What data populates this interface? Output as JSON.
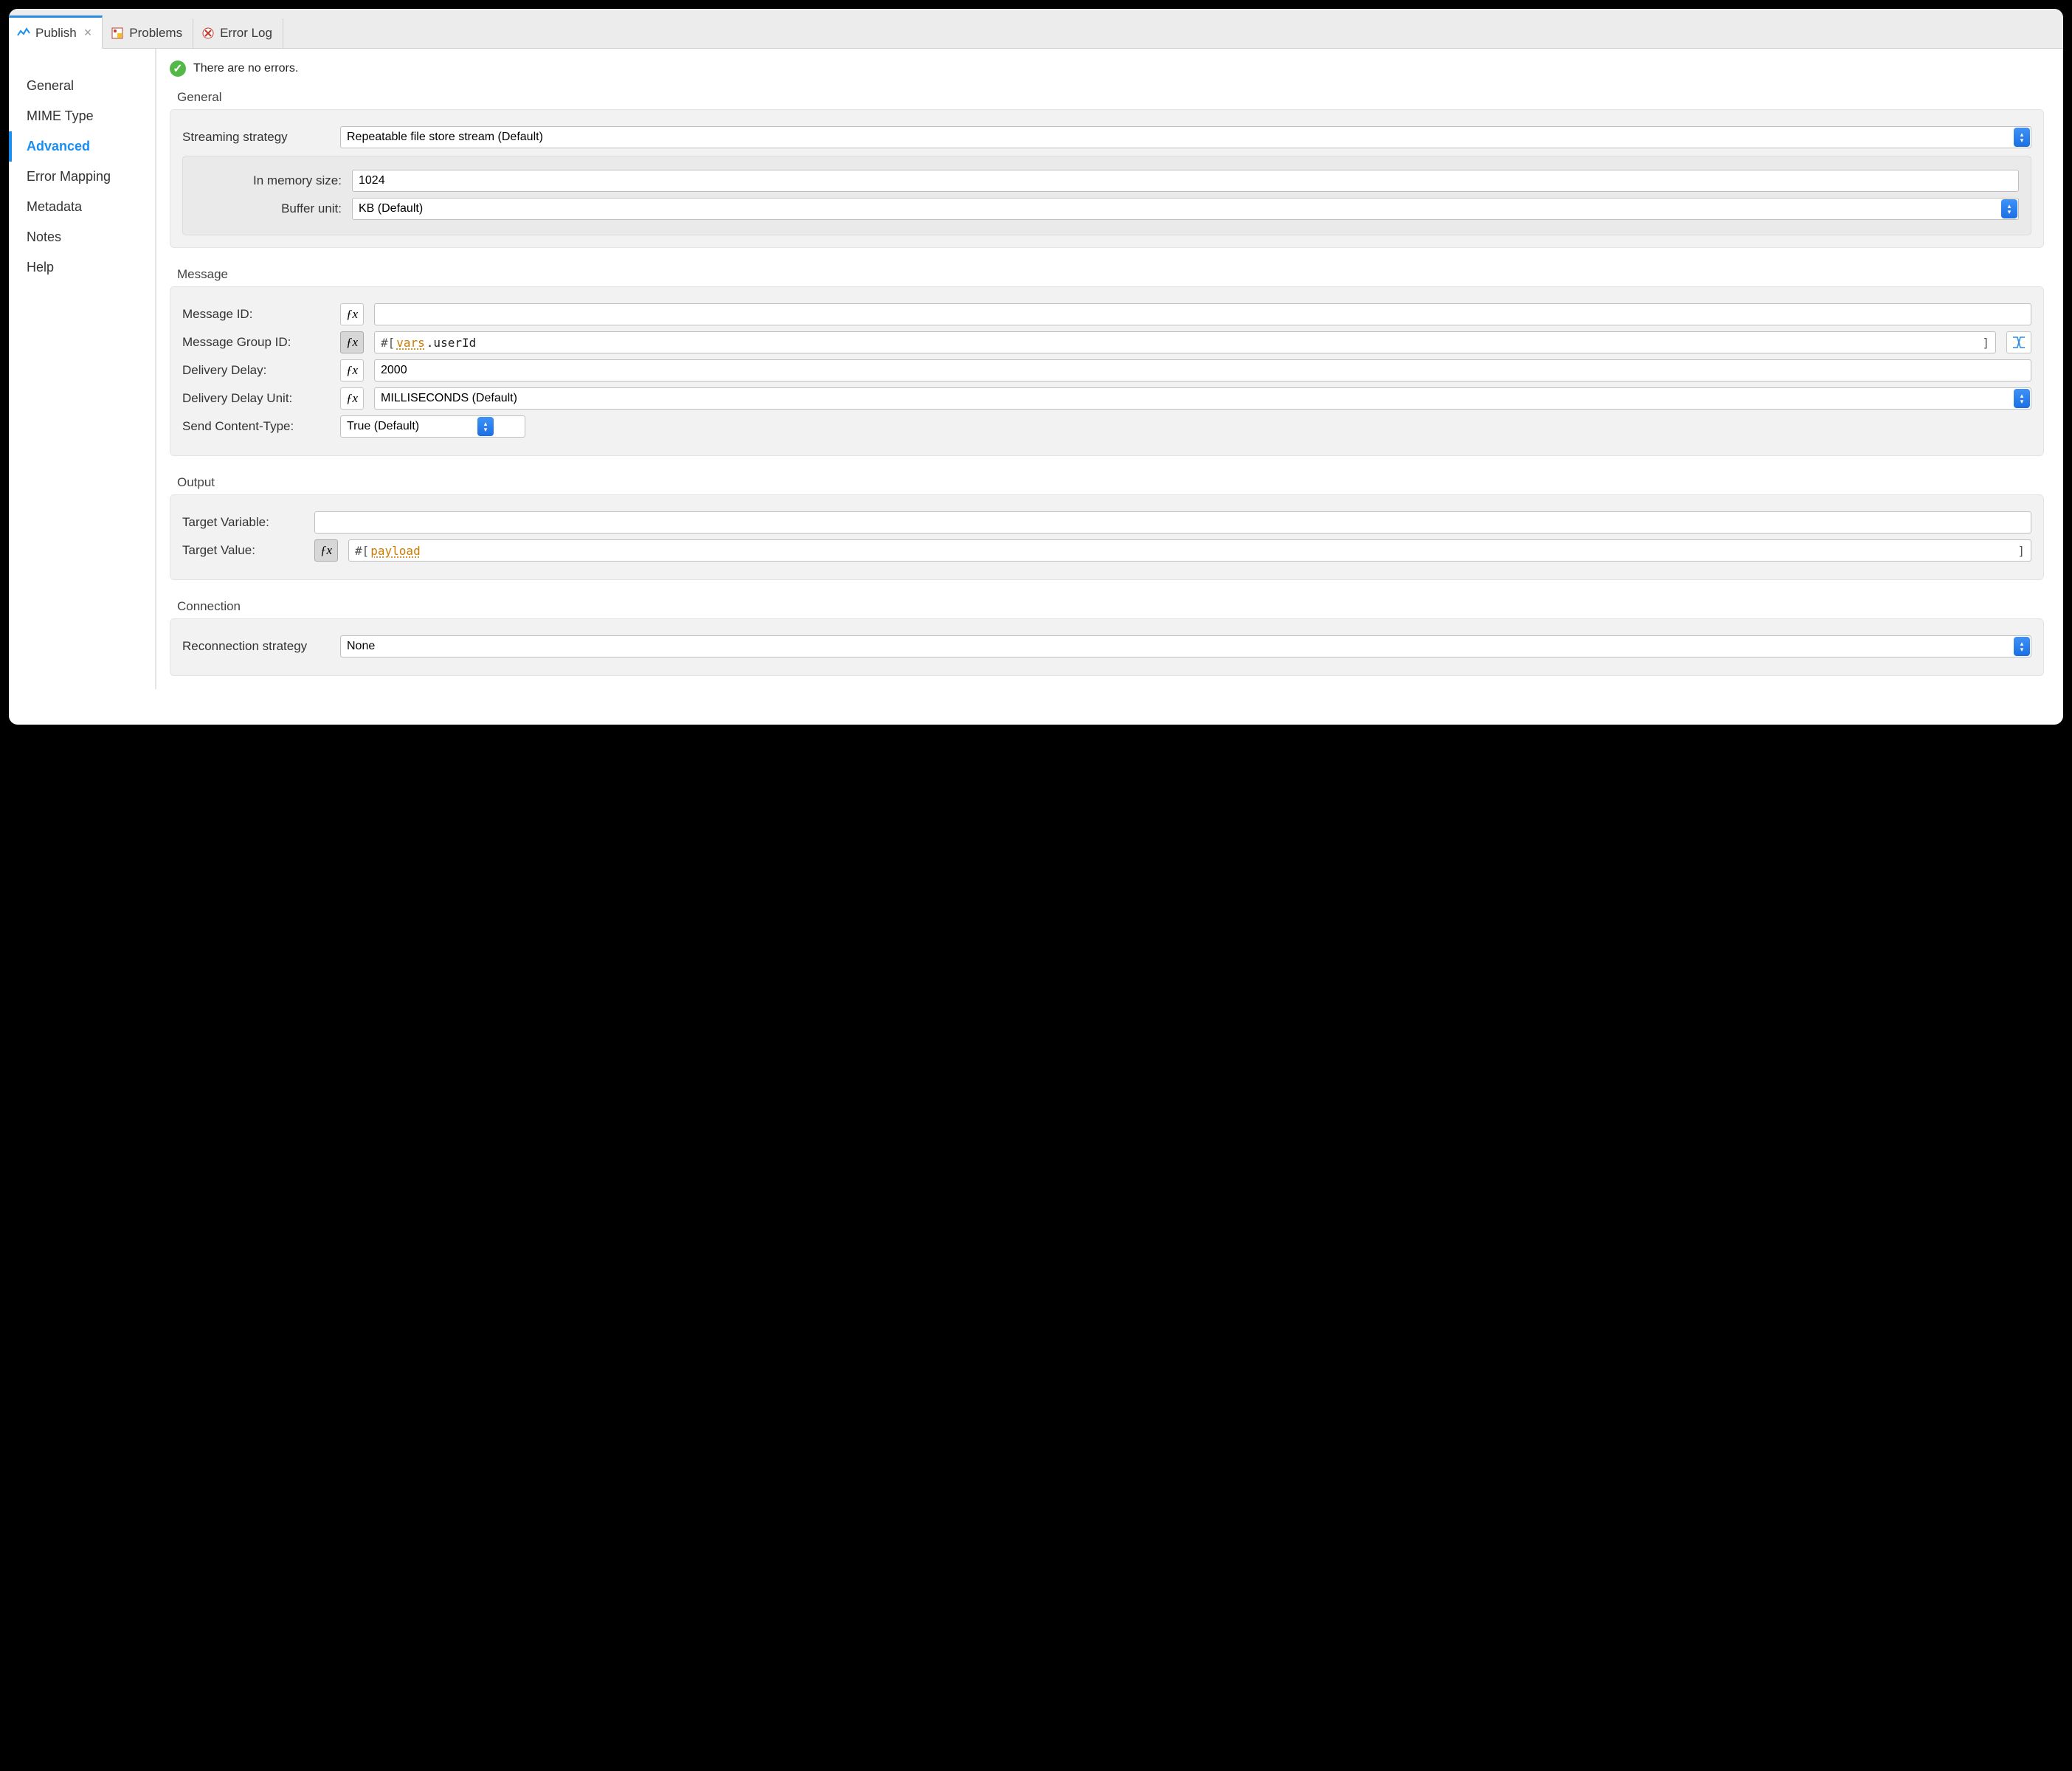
{
  "tabs": {
    "publish": {
      "label": "Publish"
    },
    "problems": {
      "label": "Problems"
    },
    "errorlog": {
      "label": "Error Log"
    }
  },
  "sidebar": {
    "items": [
      {
        "label": "General"
      },
      {
        "label": "MIME Type"
      },
      {
        "label": "Advanced"
      },
      {
        "label": "Error Mapping"
      },
      {
        "label": "Metadata"
      },
      {
        "label": "Notes"
      },
      {
        "label": "Help"
      }
    ],
    "selected_index": 2
  },
  "status": {
    "text": "There are no errors."
  },
  "sections": {
    "general": {
      "title": "General",
      "streaming_label": "Streaming strategy",
      "streaming_value": "Repeatable file store stream (Default)",
      "in_memory_label": "In memory size:",
      "in_memory_value": "1024",
      "buffer_unit_label": "Buffer unit:",
      "buffer_unit_value": "KB (Default)"
    },
    "message": {
      "title": "Message",
      "message_id_label": "Message ID:",
      "message_id_value": "",
      "message_group_label": "Message Group ID:",
      "message_group_expr_kw": "vars",
      "message_group_expr_rest": ".userId",
      "delivery_delay_label": "Delivery Delay:",
      "delivery_delay_value": "2000",
      "delivery_delay_unit_label": "Delivery Delay Unit:",
      "delivery_delay_unit_value": "MILLISECONDS (Default)",
      "send_content_type_label": "Send Content-Type:",
      "send_content_type_value": "True (Default)"
    },
    "output": {
      "title": "Output",
      "target_variable_label": "Target Variable:",
      "target_variable_value": "",
      "target_value_label": "Target Value:",
      "target_value_expr_kw": "payload",
      "target_value_expr_rest": ""
    },
    "connection": {
      "title": "Connection",
      "reconnection_label": "Reconnection strategy",
      "reconnection_value": "None"
    }
  },
  "glyphs": {
    "fx": "ƒx",
    "expr_prefix": "#[",
    "expr_suffix": "]"
  }
}
